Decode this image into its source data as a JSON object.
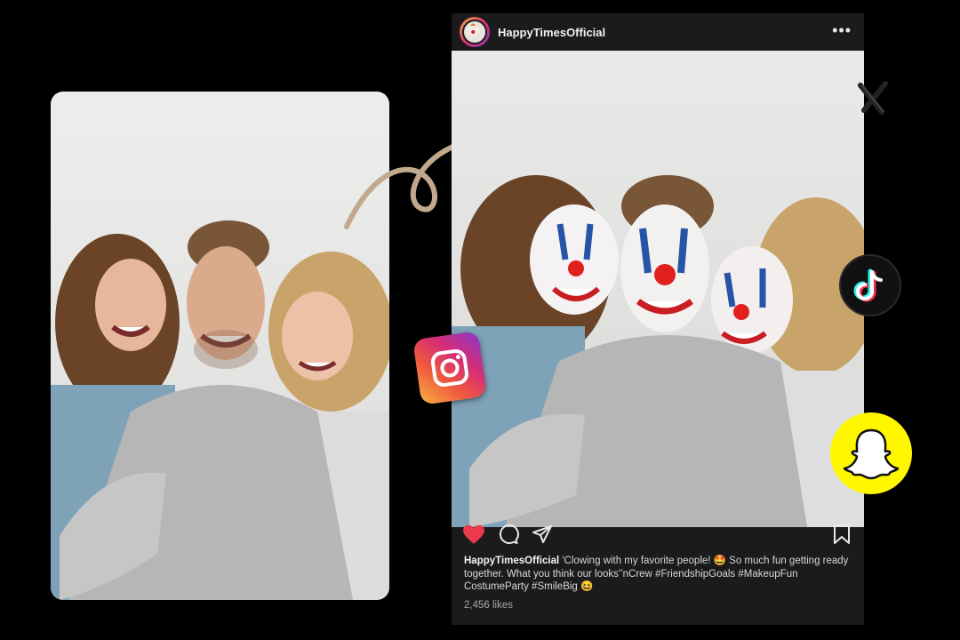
{
  "post": {
    "username": "HappyTimesOfficial",
    "caption_user": "HappyTimesOfficial",
    "caption_text": "'Clowing with my favorite people! 🤩 So much fun getting ready together. What you think our looks'’nCrew #FriendshipGoals #MakeupFun CostumeParty #SmileBig 😆",
    "likes": "2,456 likes"
  },
  "icons": {
    "more": "more-options-icon",
    "heart": "heart-icon",
    "comment": "comment-icon",
    "share": "share-icon",
    "save": "bookmark-icon"
  },
  "apps": [
    "x",
    "tiktok",
    "instagram",
    "snapchat"
  ],
  "colors": {
    "background": "#000000",
    "card": "#1b1b1d",
    "like_red": "#ed3a4a",
    "arrow": "#c2a98e",
    "snapchat_yellow": "#fff700"
  }
}
